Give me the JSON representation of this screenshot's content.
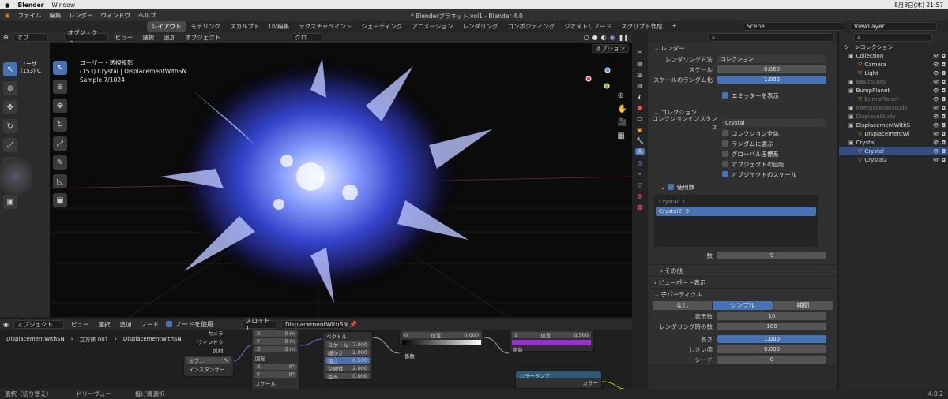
{
  "macbar": {
    "app": "Blender",
    "menu": "Window",
    "date": "8月8日(木) 21:57"
  },
  "topbar": {
    "menus": [
      "ファイル",
      "編集",
      "レンダー",
      "ウィンドウ",
      "ヘルプ"
    ],
    "title": "* Blenderプラネット.vol1 - Blender 4.0"
  },
  "workspaces": [
    "レイアウト",
    "モデリング",
    "スカルプト",
    "UV編集",
    "テクスチャペイント",
    "シェーディング",
    "アニメーション",
    "レンダリング",
    "コンポジティング",
    "ジオメトリノード",
    "スクリプト作成"
  ],
  "active_workspace": "レイアウト",
  "scene": "Scene",
  "viewlayer": "ViewLayer",
  "viewport": {
    "mode": "オブジェクト...",
    "menus": [
      "ビュー",
      "選択",
      "追加",
      "オブジェクト"
    ],
    "info1": "ユーザー・透視投影",
    "info2": "(153) Crystal | DisplacementWithSN",
    "info3": "Sample 7/1024",
    "options": "オプション",
    "left_mode": "オブ",
    "left_info1": "ユーザ",
    "left_info2": "(153) C",
    "orient": "グロ..."
  },
  "node_editor": {
    "mode": "オブジェクト",
    "menus": [
      "ビュー",
      "選択",
      "追加",
      "ノード"
    ],
    "use_nodes": "ノードを使用",
    "slot": "スロット1",
    "material": "DisplacementWithSN",
    "crumbs": [
      "DisplacementWithSN",
      "立方体.001",
      "DisplacementWithSN"
    ],
    "tex_in": [
      "カメラ",
      "ウィンドウ",
      "反射"
    ],
    "tex_obj": "オブ...",
    "tex_inst": "インスタンサー...",
    "xyz": [
      {
        "l": "X",
        "v": "0 m"
      },
      {
        "l": "Y",
        "v": "0 m"
      },
      {
        "l": "Z",
        "v": "0 m"
      }
    ],
    "rot": "回転",
    "rxyz": [
      {
        "l": "X",
        "v": "0°"
      },
      {
        "l": "Y",
        "v": "0°"
      },
      {
        "l": "Z",
        "v": "0°"
      }
    ],
    "scale_lbl": "スケール",
    "noise": {
      "vec": "ベクトル",
      "rows": [
        {
          "l": "スケール",
          "v": "7.000"
        },
        {
          "l": "細かさ",
          "v": "2.000"
        },
        {
          "l": "粗さ",
          "v": "0.500"
        },
        {
          "l": "空隙性",
          "v": "2.000"
        },
        {
          "l": "歪み",
          "v": "0.000"
        }
      ]
    },
    "cr": {
      "a": "0",
      "b": "位置",
      "c": "0.000",
      "fac": "係数"
    },
    "cr2": {
      "a": "1",
      "b": "位置",
      "c": "0.500",
      "fac": "係数"
    },
    "ramp": "カラーランプ",
    "color": "カラー"
  },
  "status": [
    "選択（切り替え）",
    "ドリーヴュー",
    "投げ縄選択"
  ],
  "version": "4.0.2",
  "props": {
    "render_head": "レンダー",
    "rows1": [
      {
        "l": "レンダリング方法",
        "v": "コレクション"
      },
      {
        "l": "スケール",
        "v": "0.060"
      },
      {
        "l": "スケールのランダム化",
        "v": "1.000"
      }
    ],
    "emitter": "エミッターを表示",
    "coll_head": "コレクション",
    "coll_inst_lbl": "コレクションインスタンス",
    "coll_inst": "Crystal",
    "checks": [
      {
        "l": "コレクション全体",
        "on": false
      },
      {
        "l": "ランダムに選ぶ",
        "on": false
      },
      {
        "l": "グローバル座標系",
        "on": false
      },
      {
        "l": "オブジェクトの回転",
        "on": false
      },
      {
        "l": "オブジェクトのスケール",
        "on": true
      }
    ],
    "use_count": "使用数",
    "list": [
      "Crystal: 1",
      "Crystal2: 9"
    ],
    "count_lbl": "数",
    "count": "9",
    "other": "その他",
    "vp_disp": "ビューポート表示",
    "child": "子パーティクル",
    "child_tabs": [
      "なし",
      "シンプル",
      "補間"
    ],
    "child_rows": [
      {
        "l": "表示数",
        "v": "10"
      },
      {
        "l": "レンダリング時の数",
        "v": "100"
      }
    ],
    "child_rows2": [
      {
        "l": "長さ",
        "v": "1.000",
        "blue": true
      },
      {
        "l": "しきい値",
        "v": "0.000"
      },
      {
        "l": "シード",
        "v": "0"
      }
    ]
  },
  "outliner": {
    "head": "シーンコレクション",
    "rows": [
      {
        "t": "Collection",
        "ind": 1,
        "dim": false
      },
      {
        "t": "Camera",
        "ind": 2,
        "dim": false
      },
      {
        "t": "Light",
        "ind": 2,
        "dim": false
      },
      {
        "t": "BasicStudy",
        "ind": 1,
        "dim": true
      },
      {
        "t": "BumpPlanet",
        "ind": 1,
        "dim": false
      },
      {
        "t": "BumpPlanet",
        "ind": 2,
        "dim": true
      },
      {
        "t": "InterpolationStudy",
        "ind": 1,
        "dim": true
      },
      {
        "t": "DisplaceStudy",
        "ind": 1,
        "dim": true
      },
      {
        "t": "DisplacementWithS",
        "ind": 1,
        "dim": false
      },
      {
        "t": "DisplacementWi",
        "ind": 2,
        "dim": false
      },
      {
        "t": "Crystal",
        "ind": 1,
        "dim": false
      },
      {
        "t": "Crystal",
        "ind": 2,
        "dim": false
      },
      {
        "t": "Crystal2",
        "ind": 2,
        "dim": false
      }
    ]
  }
}
